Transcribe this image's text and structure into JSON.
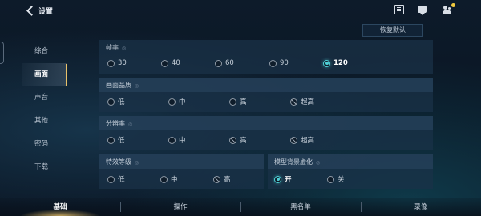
{
  "header": {
    "back_label": "设置",
    "icons": [
      "notes-icon",
      "chat-icon",
      "friends-icon"
    ]
  },
  "reset_button": "恢复默认",
  "sidebar": {
    "items": [
      {
        "label": "综合",
        "active": false
      },
      {
        "label": "画面",
        "active": true
      },
      {
        "label": "声音",
        "active": false
      },
      {
        "label": "其他",
        "active": false
      },
      {
        "label": "密码",
        "active": false
      },
      {
        "label": "下载",
        "active": false
      }
    ]
  },
  "sections": {
    "frame_rate": {
      "title": "帧率",
      "options": [
        "30",
        "40",
        "60",
        "90",
        "120"
      ],
      "selected": "120"
    },
    "quality": {
      "title": "画面品质",
      "options": [
        "低",
        "中",
        "高",
        "超高"
      ],
      "selected": null,
      "blocked": [
        "超高"
      ]
    },
    "resolution": {
      "title": "分辨率",
      "options": [
        "低",
        "中",
        "高",
        "超高"
      ],
      "selected": null,
      "blocked": [
        "高",
        "超高"
      ]
    },
    "effects": {
      "title": "特效等级",
      "options": [
        "低",
        "中",
        "高"
      ],
      "selected": null,
      "blocked": [
        "高"
      ]
    },
    "model_bg_blur": {
      "title": "模型背景虚化",
      "options": [
        "开",
        "关"
      ],
      "selected": "开"
    }
  },
  "bottom_tabs": [
    {
      "label": "基础",
      "active": true
    },
    {
      "label": "操作",
      "active": false
    },
    {
      "label": "黑名单",
      "active": false
    },
    {
      "label": "录像",
      "active": false
    }
  ],
  "colors": {
    "accent_selected": "#4fd0d6",
    "active_marker": "#e8c16a",
    "notification_dot": "#f0c93e"
  }
}
